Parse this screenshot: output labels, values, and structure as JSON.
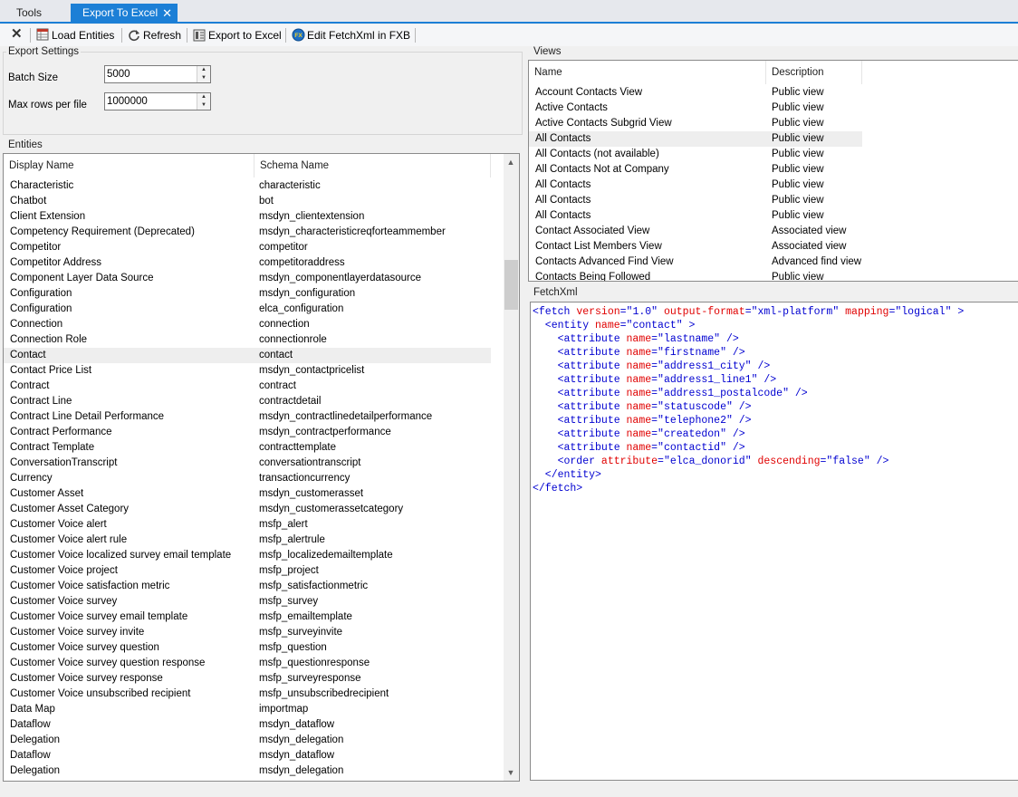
{
  "tabs": [
    {
      "label": "Tools"
    },
    {
      "label": "Export To Excel",
      "close": "✕"
    }
  ],
  "toolbar": {
    "close_glyph": "✕",
    "load_entities": "Load Entities",
    "refresh": "Refresh",
    "export_to_excel": "Export to Excel",
    "edit_fetchxml": "Edit FetchXml in FXB"
  },
  "export_settings": {
    "title": "Export Settings",
    "batch_size_label": "Batch Size",
    "batch_size_value": "5000",
    "max_rows_label": "Max rows per file",
    "max_rows_value": "1000000"
  },
  "entities": {
    "title": "Entities",
    "col_display": "Display Name",
    "col_schema": "Schema Name",
    "selected_index": 11,
    "rows": [
      [
        "Characteristic",
        "characteristic"
      ],
      [
        "Chatbot",
        "bot"
      ],
      [
        "Client Extension",
        "msdyn_clientextension"
      ],
      [
        "Competency Requirement (Deprecated)",
        "msdyn_characteristicreqforteammember"
      ],
      [
        "Competitor",
        "competitor"
      ],
      [
        "Competitor Address",
        "competitoraddress"
      ],
      [
        "Component Layer Data Source",
        "msdyn_componentlayerdatasource"
      ],
      [
        "Configuration",
        "msdyn_configuration"
      ],
      [
        "Configuration",
        "elca_configuration"
      ],
      [
        "Connection",
        "connection"
      ],
      [
        "Connection Role",
        "connectionrole"
      ],
      [
        "Contact",
        "contact"
      ],
      [
        "Contact Price List",
        "msdyn_contactpricelist"
      ],
      [
        "Contract",
        "contract"
      ],
      [
        "Contract Line",
        "contractdetail"
      ],
      [
        "Contract Line Detail Performance",
        "msdyn_contractlinedetailperformance"
      ],
      [
        "Contract Performance",
        "msdyn_contractperformance"
      ],
      [
        "Contract Template",
        "contracttemplate"
      ],
      [
        "ConversationTranscript",
        "conversationtranscript"
      ],
      [
        "Currency",
        "transactioncurrency"
      ],
      [
        "Customer Asset",
        "msdyn_customerasset"
      ],
      [
        "Customer Asset Category",
        "msdyn_customerassetcategory"
      ],
      [
        "Customer Voice alert",
        "msfp_alert"
      ],
      [
        "Customer Voice alert rule",
        "msfp_alertrule"
      ],
      [
        "Customer Voice localized survey email template",
        "msfp_localizedemailtemplate"
      ],
      [
        "Customer Voice project",
        "msfp_project"
      ],
      [
        "Customer Voice satisfaction metric",
        "msfp_satisfactionmetric"
      ],
      [
        "Customer Voice survey",
        "msfp_survey"
      ],
      [
        "Customer Voice survey email template",
        "msfp_emailtemplate"
      ],
      [
        "Customer Voice survey invite",
        "msfp_surveyinvite"
      ],
      [
        "Customer Voice survey question",
        "msfp_question"
      ],
      [
        "Customer Voice survey question response",
        "msfp_questionresponse"
      ],
      [
        "Customer Voice survey response",
        "msfp_surveyresponse"
      ],
      [
        "Customer Voice unsubscribed recipient",
        "msfp_unsubscribedrecipient"
      ],
      [
        "Data Map",
        "importmap"
      ],
      [
        "Dataflow",
        "msdyn_dataflow"
      ],
      [
        "Delegation",
        "msdyn_delegation"
      ],
      [
        "Dataflow",
        "msdyn_dataflow"
      ],
      [
        "Delegation",
        "msdyn_delegation"
      ]
    ]
  },
  "views": {
    "title": "Views",
    "col_name": "Name",
    "col_description": "Description",
    "selected_index": 3,
    "rows": [
      [
        "Account Contacts View",
        "Public view"
      ],
      [
        "Active Contacts",
        "Public view"
      ],
      [
        "Active Contacts Subgrid View",
        "Public view"
      ],
      [
        "All Contacts",
        "Public view"
      ],
      [
        "All Contacts (not available)",
        "Public view"
      ],
      [
        "All Contacts Not at Company",
        "Public view"
      ],
      [
        "All  Contacts",
        "Public view"
      ],
      [
        "All  Contacts",
        "Public view"
      ],
      [
        "All  Contacts",
        "Public view"
      ],
      [
        "Contact Associated View",
        "Associated view"
      ],
      [
        "Contact List Members View",
        "Associated view"
      ],
      [
        "Contacts Advanced Find View",
        "Advanced find view"
      ],
      [
        "Contacts Being Followed",
        "Public view"
      ]
    ]
  },
  "fetchxml": {
    "title": "FetchXml",
    "lines": [
      [
        [
          "t",
          "<fetch "
        ],
        [
          "a",
          "version"
        ],
        [
          "t",
          "=\""
        ],
        [
          "v",
          "1.0"
        ],
        [
          "t",
          "\" "
        ],
        [
          "a",
          "output-format"
        ],
        [
          "t",
          "=\""
        ],
        [
          "v",
          "xml-platform"
        ],
        [
          "t",
          "\" "
        ],
        [
          "a",
          "mapping"
        ],
        [
          "t",
          "=\""
        ],
        [
          "v",
          "logical"
        ],
        [
          "t",
          "\" >"
        ]
      ],
      [
        [
          "t",
          "  <entity "
        ],
        [
          "a",
          "name"
        ],
        [
          "t",
          "=\""
        ],
        [
          "v",
          "contact"
        ],
        [
          "t",
          "\" >"
        ]
      ],
      [
        [
          "t",
          "    <attribute "
        ],
        [
          "a",
          "name"
        ],
        [
          "t",
          "=\""
        ],
        [
          "v",
          "lastname"
        ],
        [
          "t",
          "\" />"
        ]
      ],
      [
        [
          "t",
          "    <attribute "
        ],
        [
          "a",
          "name"
        ],
        [
          "t",
          "=\""
        ],
        [
          "v",
          "firstname"
        ],
        [
          "t",
          "\" />"
        ]
      ],
      [
        [
          "t",
          "    <attribute "
        ],
        [
          "a",
          "name"
        ],
        [
          "t",
          "=\""
        ],
        [
          "v",
          "address1_city"
        ],
        [
          "t",
          "\" />"
        ]
      ],
      [
        [
          "t",
          "    <attribute "
        ],
        [
          "a",
          "name"
        ],
        [
          "t",
          "=\""
        ],
        [
          "v",
          "address1_line1"
        ],
        [
          "t",
          "\" />"
        ]
      ],
      [
        [
          "t",
          "    <attribute "
        ],
        [
          "a",
          "name"
        ],
        [
          "t",
          "=\""
        ],
        [
          "v",
          "address1_postalcode"
        ],
        [
          "t",
          "\" />"
        ]
      ],
      [
        [
          "t",
          "    <attribute "
        ],
        [
          "a",
          "name"
        ],
        [
          "t",
          "=\""
        ],
        [
          "v",
          "statuscode"
        ],
        [
          "t",
          "\" />"
        ]
      ],
      [
        [
          "t",
          "    <attribute "
        ],
        [
          "a",
          "name"
        ],
        [
          "t",
          "=\""
        ],
        [
          "v",
          "telephone2"
        ],
        [
          "t",
          "\" />"
        ]
      ],
      [
        [
          "t",
          "    <attribute "
        ],
        [
          "a",
          "name"
        ],
        [
          "t",
          "=\""
        ],
        [
          "v",
          "createdon"
        ],
        [
          "t",
          "\" />"
        ]
      ],
      [
        [
          "t",
          "    <attribute "
        ],
        [
          "a",
          "name"
        ],
        [
          "t",
          "=\""
        ],
        [
          "v",
          "contactid"
        ],
        [
          "t",
          "\" />"
        ]
      ],
      [
        [
          "t",
          "    <order "
        ],
        [
          "a",
          "attribute"
        ],
        [
          "t",
          "=\""
        ],
        [
          "v",
          "elca_donorid"
        ],
        [
          "t",
          "\" "
        ],
        [
          "a",
          "descending"
        ],
        [
          "t",
          "=\""
        ],
        [
          "v",
          "false"
        ],
        [
          "t",
          "\" />"
        ]
      ],
      [
        [
          "t",
          "  </entity>"
        ]
      ],
      [
        [
          "t",
          "</fetch>"
        ]
      ]
    ]
  },
  "colors": {
    "accent": "#1c7fd6",
    "xml_tag": "#0000d0",
    "xml_attr": "#e00000"
  }
}
